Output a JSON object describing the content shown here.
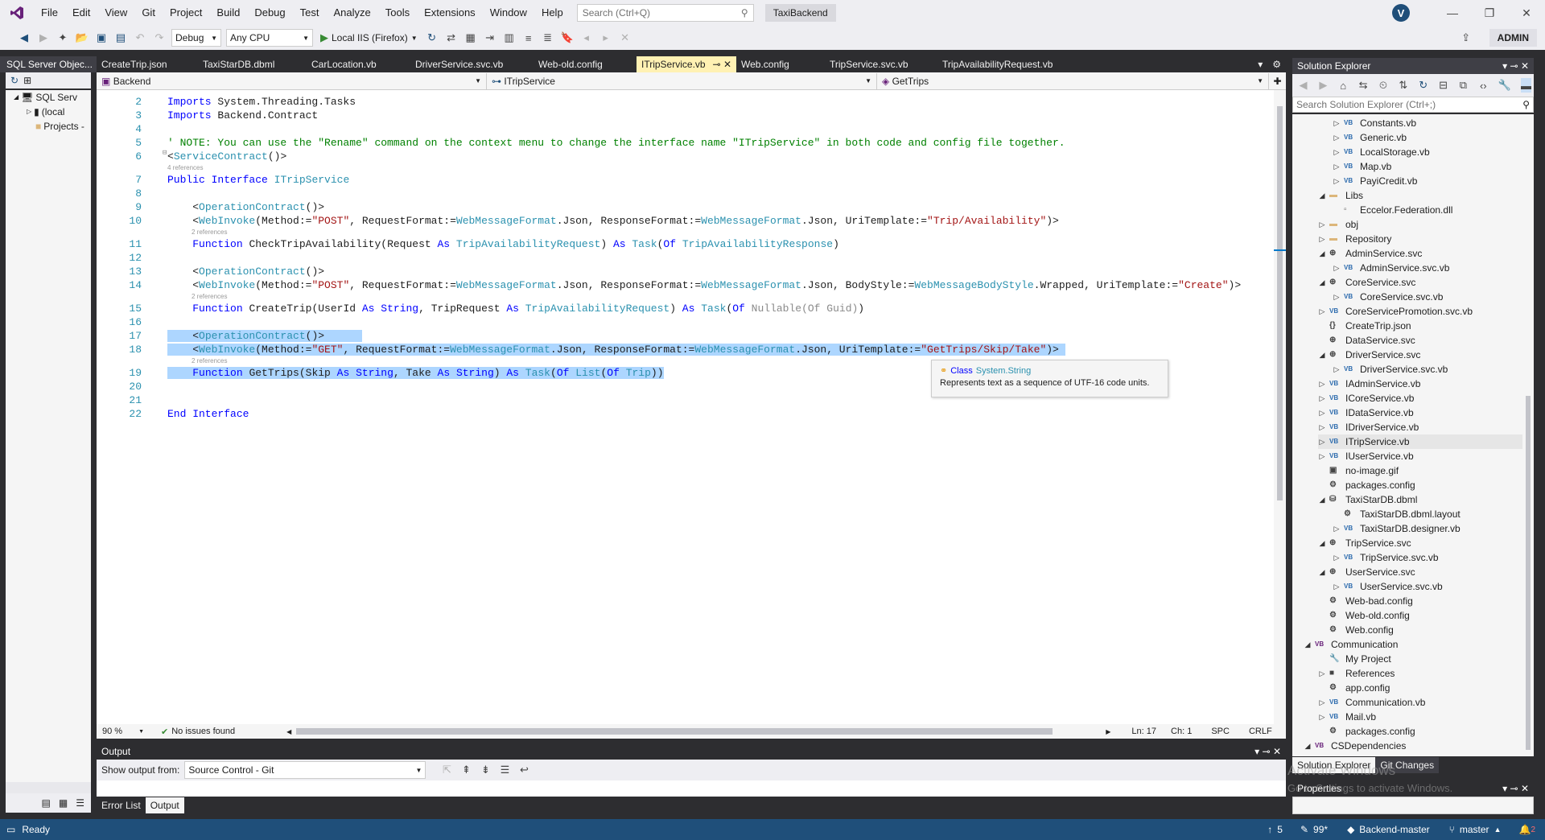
{
  "titlebar": {
    "menu": [
      "File",
      "Edit",
      "View",
      "Git",
      "Project",
      "Build",
      "Debug",
      "Test",
      "Analyze",
      "Tools",
      "Extensions",
      "Window",
      "Help"
    ],
    "search_placeholder": "Search (Ctrl+Q)",
    "solution_name": "TaxiBackend",
    "avatar_letter": "V"
  },
  "toolbar": {
    "config": "Debug",
    "platform": "Any CPU",
    "run_target": "Local IIS (Firefox)",
    "admin_label": "ADMIN"
  },
  "left_panel": {
    "title": "SQL Server Objec...",
    "items": [
      "SQL Serv",
      "(local",
      "Projects -"
    ]
  },
  "tabs": [
    "CreateTrip.json",
    "TaxiStarDB.dbml",
    "CarLocation.vb",
    "DriverService.svc.vb",
    "Web-old.config",
    "ITripService.vb",
    "Web.config",
    "TripService.svc.vb",
    "TripAvailabilityRequest.vb"
  ],
  "active_tab": "ITripService.vb",
  "navbar": {
    "project": "Backend",
    "type": "ITripService",
    "member": "GetTrips"
  },
  "editor": {
    "line_numbers": [
      "2",
      "3",
      "4",
      "5",
      "6",
      "7",
      "8",
      "9",
      "10",
      "11",
      "12",
      "13",
      "14",
      "15",
      "16",
      "17",
      "18",
      "19",
      "20",
      "21",
      "22"
    ],
    "lines": {
      "l2": "Imports System.Threading.Tasks",
      "l3": "Imports Backend.Contract",
      "l5": "' NOTE: You can use the \"Rename\" command on the context menu to change the interface name \"ITripService\" in both code and config file together.",
      "l22": "End Interface"
    },
    "lens_4refs": "4 references",
    "lens_2refs": "2 references"
  },
  "tooltip": {
    "kind": "Class",
    "name": "System.String",
    "desc": "Represents text as a sequence of UTF-16 code units."
  },
  "editor_status": {
    "zoom": "90 %",
    "issues": "No issues found",
    "ln": "Ln: 17",
    "ch": "Ch: 1",
    "spc": "SPC",
    "eol": "CRLF"
  },
  "solution_explorer": {
    "title": "Solution Explorer",
    "search_placeholder": "Search Solution Explorer (Ctrl+;)",
    "items": [
      {
        "label": "Constants.vb",
        "icon": "VB",
        "indent": 3,
        "arrow": "right"
      },
      {
        "label": "Generic.vb",
        "icon": "VB",
        "indent": 3,
        "arrow": "right"
      },
      {
        "label": "LocalStorage.vb",
        "icon": "VB",
        "indent": 3,
        "arrow": "right"
      },
      {
        "label": "Map.vb",
        "icon": "VB",
        "indent": 3,
        "arrow": "right"
      },
      {
        "label": "PayiCredit.vb",
        "icon": "VB",
        "indent": 3,
        "arrow": "right"
      },
      {
        "label": "Libs",
        "icon": "folder",
        "indent": 2,
        "arrow": "down"
      },
      {
        "label": "Eccelor.Federation.dll",
        "icon": "dll",
        "indent": 3,
        "arrow": ""
      },
      {
        "label": "obj",
        "icon": "folder",
        "indent": 2,
        "arrow": "right"
      },
      {
        "label": "Repository",
        "icon": "folder",
        "indent": 2,
        "arrow": "right"
      },
      {
        "label": "AdminService.svc",
        "icon": "svc",
        "indent": 2,
        "arrow": "down"
      },
      {
        "label": "AdminService.svc.vb",
        "icon": "VB",
        "indent": 3,
        "arrow": "right"
      },
      {
        "label": "CoreService.svc",
        "icon": "svc",
        "indent": 2,
        "arrow": "down"
      },
      {
        "label": "CoreService.svc.vb",
        "icon": "VB",
        "indent": 3,
        "arrow": "right"
      },
      {
        "label": "CoreServicePromotion.svc.vb",
        "icon": "VB",
        "indent": 2,
        "arrow": "right"
      },
      {
        "label": "CreateTrip.json",
        "icon": "json",
        "indent": 2,
        "arrow": ""
      },
      {
        "label": "DataService.svc",
        "icon": "svc",
        "indent": 2,
        "arrow": ""
      },
      {
        "label": "DriverService.svc",
        "icon": "svc",
        "indent": 2,
        "arrow": "down"
      },
      {
        "label": "DriverService.svc.vb",
        "icon": "VB",
        "indent": 3,
        "arrow": "right"
      },
      {
        "label": "IAdminService.vb",
        "icon": "VB",
        "indent": 2,
        "arrow": "right"
      },
      {
        "label": "ICoreService.vb",
        "icon": "VB",
        "indent": 2,
        "arrow": "right"
      },
      {
        "label": "IDataService.vb",
        "icon": "VB",
        "indent": 2,
        "arrow": "right"
      },
      {
        "label": "IDriverService.vb",
        "icon": "VB",
        "indent": 2,
        "arrow": "right"
      },
      {
        "label": "ITripService.vb",
        "icon": "VB",
        "indent": 2,
        "arrow": "right",
        "selected": true
      },
      {
        "label": "IUserService.vb",
        "icon": "VB",
        "indent": 2,
        "arrow": "right"
      },
      {
        "label": "no-image.gif",
        "icon": "img",
        "indent": 2,
        "arrow": ""
      },
      {
        "label": "packages.config",
        "icon": "cfg",
        "indent": 2,
        "arrow": ""
      },
      {
        "label": "TaxiStarDB.dbml",
        "icon": "dbml",
        "indent": 2,
        "arrow": "down"
      },
      {
        "label": "TaxiStarDB.dbml.layout",
        "icon": "cfg",
        "indent": 3,
        "arrow": ""
      },
      {
        "label": "TaxiStarDB.designer.vb",
        "icon": "VB",
        "indent": 3,
        "arrow": "right"
      },
      {
        "label": "TripService.svc",
        "icon": "svc",
        "indent": 2,
        "arrow": "down"
      },
      {
        "label": "TripService.svc.vb",
        "icon": "VB",
        "indent": 3,
        "arrow": "right"
      },
      {
        "label": "UserService.svc",
        "icon": "svc",
        "indent": 2,
        "arrow": "down"
      },
      {
        "label": "UserService.svc.vb",
        "icon": "VB",
        "indent": 3,
        "arrow": "right"
      },
      {
        "label": "Web-bad.config",
        "icon": "cfg",
        "indent": 2,
        "arrow": ""
      },
      {
        "label": "Web-old.config",
        "icon": "cfg",
        "indent": 2,
        "arrow": ""
      },
      {
        "label": "Web.config",
        "icon": "cfg",
        "indent": 2,
        "arrow": ""
      },
      {
        "label": "Communication",
        "icon": "proj",
        "indent": 1,
        "arrow": "down"
      },
      {
        "label": "My Project",
        "icon": "wrench",
        "indent": 2,
        "arrow": ""
      },
      {
        "label": "References",
        "icon": "ref",
        "indent": 2,
        "arrow": "right"
      },
      {
        "label": "app.config",
        "icon": "cfg",
        "indent": 2,
        "arrow": ""
      },
      {
        "label": "Communication.vb",
        "icon": "VB",
        "indent": 2,
        "arrow": "right"
      },
      {
        "label": "Mail.vb",
        "icon": "VB",
        "indent": 2,
        "arrow": "right"
      },
      {
        "label": "packages.config",
        "icon": "cfg",
        "indent": 2,
        "arrow": ""
      },
      {
        "label": "CSDependencies",
        "icon": "proj",
        "indent": 1,
        "arrow": "down"
      }
    ],
    "bottom_tabs": [
      "Solution Explorer",
      "Git Changes"
    ],
    "properties_title": "Properties",
    "watermark1": "Activate Windows",
    "watermark2": "Go to Settings to activate Windows."
  },
  "output": {
    "title": "Output",
    "show_label": "Show output from:",
    "source": "Source Control - Git",
    "bottom_tabs": [
      "Error List",
      "Output"
    ]
  },
  "statusbar": {
    "ready": "Ready",
    "up": "5",
    "pencil": "99*",
    "repo": "Backend-master",
    "branch": "master",
    "notifications": "2"
  },
  "colors": {
    "accent": "#007acc",
    "statusbar": "#1f4f7a",
    "selection": "#add6ff",
    "keyword": "#0000ff",
    "type": "#2b91af",
    "string": "#a31515",
    "comment": "#008000"
  }
}
